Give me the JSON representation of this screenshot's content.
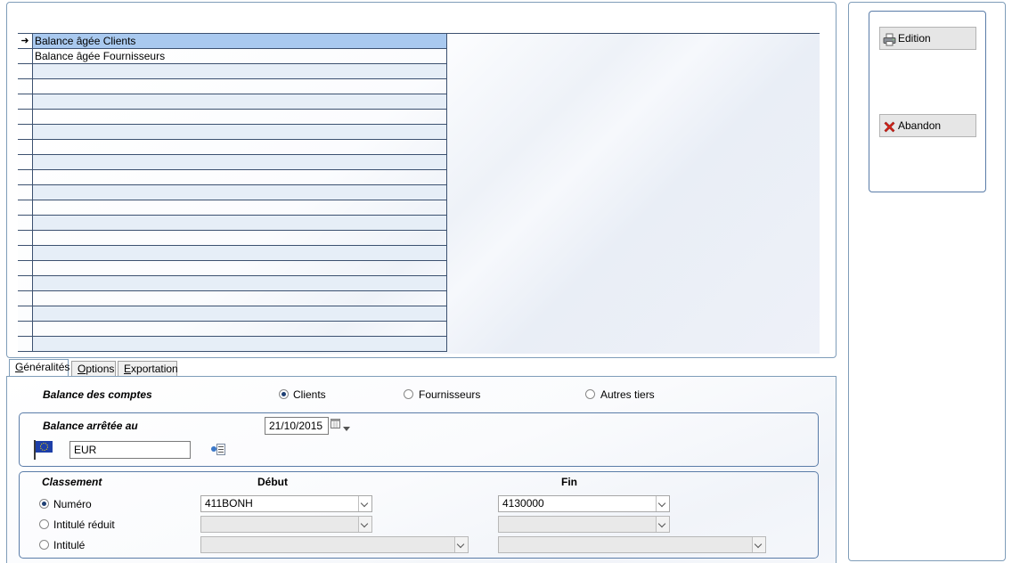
{
  "list": {
    "rows": [
      {
        "label": "Balance âgée Clients",
        "selected": true,
        "indicator": "➜"
      },
      {
        "label": "Balance âgée Fournisseurs"
      },
      {
        "label": ""
      },
      {
        "label": ""
      },
      {
        "label": ""
      },
      {
        "label": ""
      },
      {
        "label": ""
      },
      {
        "label": ""
      },
      {
        "label": ""
      },
      {
        "label": ""
      },
      {
        "label": ""
      },
      {
        "label": ""
      },
      {
        "label": ""
      },
      {
        "label": ""
      },
      {
        "label": ""
      },
      {
        "label": ""
      },
      {
        "label": ""
      },
      {
        "label": ""
      },
      {
        "label": ""
      },
      {
        "label": ""
      },
      {
        "label": ""
      }
    ]
  },
  "tabs": [
    {
      "label": "Généralités",
      "underline": "G",
      "rest": "énéralités",
      "active": true
    },
    {
      "label": "Options",
      "underline": "O",
      "rest": "ptions"
    },
    {
      "label": "Exportation",
      "underline": "E",
      "rest": "xportation"
    }
  ],
  "form": {
    "balance_label": "Balance des comptes",
    "balance_options": [
      {
        "label": "Clients",
        "checked": true
      },
      {
        "label": "Fournisseurs",
        "checked": false
      },
      {
        "label": "Autres tiers",
        "checked": false
      }
    ],
    "arretee_label": "Balance arrêtée au",
    "date_value": "21/10/2015",
    "currency_value": "EUR",
    "classement_label": "Classement",
    "debut_header": "Début",
    "fin_header": "Fin",
    "classement_options": [
      {
        "label": "Numéro",
        "checked": true,
        "debut": "411BONH",
        "fin": "4130000"
      },
      {
        "label": "Intitulé réduit",
        "checked": false,
        "debut": "",
        "fin": ""
      },
      {
        "label": "Intitulé",
        "checked": false,
        "debut": "",
        "fin": ""
      }
    ]
  },
  "actions": {
    "edition_label": "Edition",
    "abandon_label": "Abandon"
  },
  "colors": {
    "selected_row": "#a9c9ef",
    "alt_row": "#e6eef7",
    "border": "#7f9db9",
    "abandon_red": "#d9261c"
  },
  "icons": {
    "row_indicator": "arrow-right-icon",
    "date_picker": "calendar-icon",
    "currency": "eu-flag-icon",
    "currency_list": "list-icon",
    "edition": "printer-icon",
    "abandon": "red-x-icon"
  }
}
